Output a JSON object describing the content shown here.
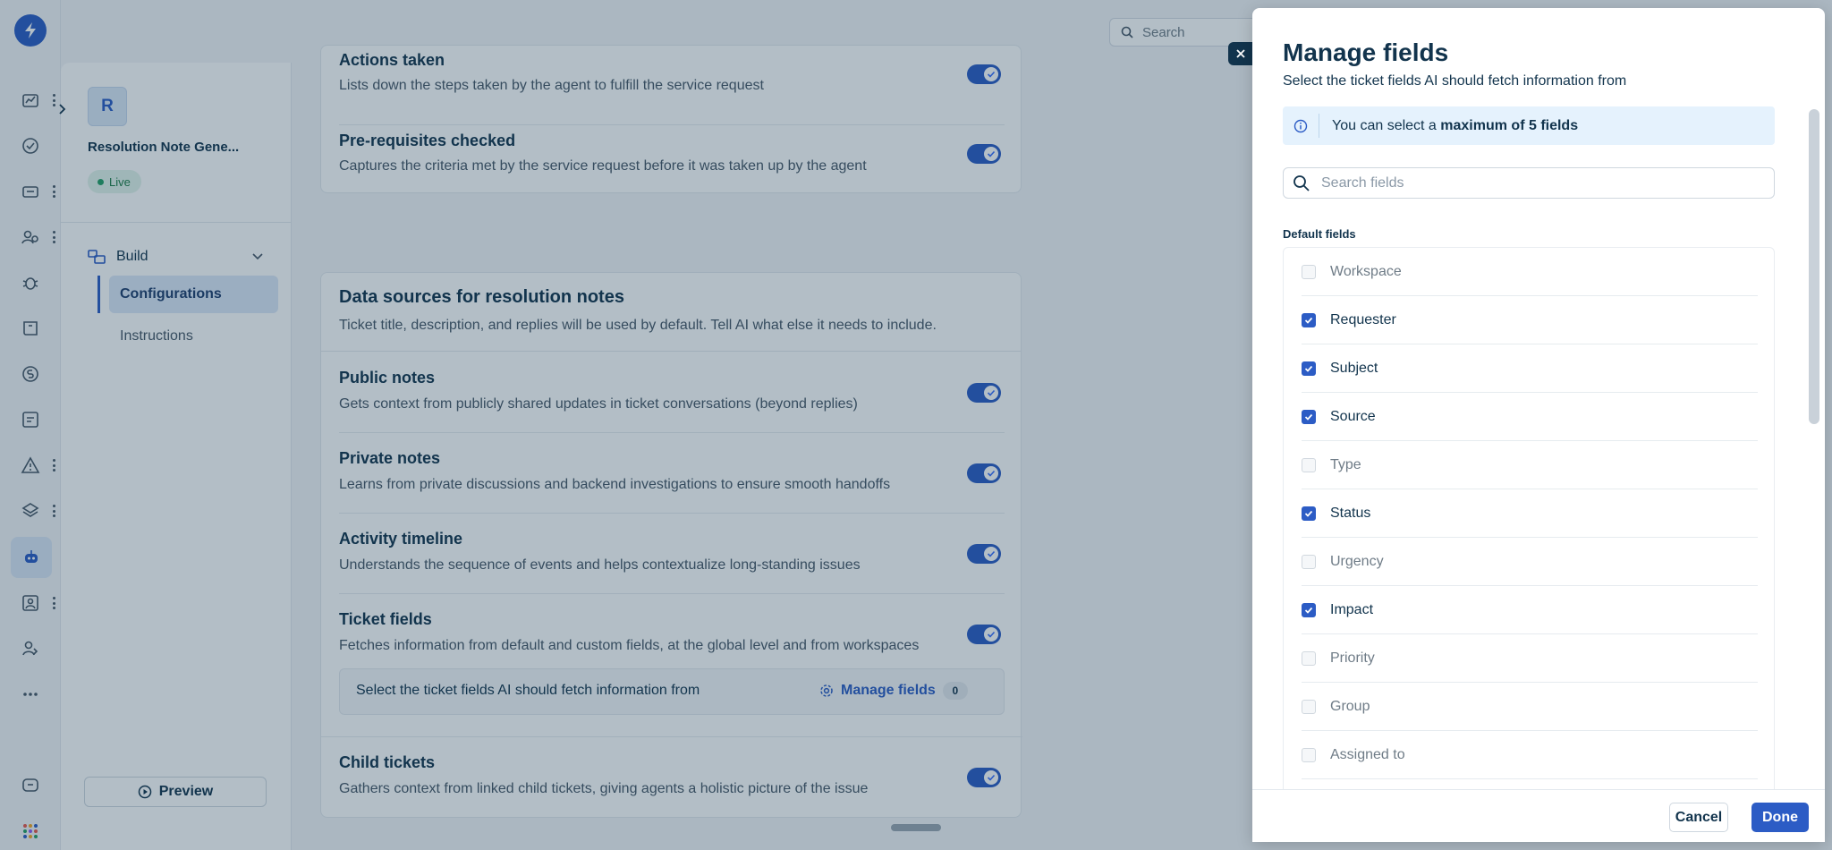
{
  "search": {
    "placeholder": "Search"
  },
  "agent": {
    "avatar_letter": "R",
    "name": "Resolution Note Gene...",
    "status": "Live"
  },
  "nav": {
    "build_label": "Build",
    "items": [
      {
        "label": "Configurations"
      },
      {
        "label": "Instructions"
      }
    ],
    "preview_label": "Preview"
  },
  "rail": {
    "icons": [
      "dashboard-icon",
      "check-icon",
      "tickets-icon",
      "contacts-icon",
      "bug-icon",
      "book-icon",
      "billing-icon",
      "reports-icon",
      "alert-icon",
      "layers-icon",
      "bot-icon",
      "inbox-icon",
      "team-icon",
      "more-icon",
      "chat-icon",
      "apps-icon"
    ]
  },
  "actions_card": {
    "rows": [
      {
        "title": "Actions taken",
        "desc": "Lists down the steps taken by the agent to fulfill the service request",
        "enabled": true
      },
      {
        "title": "Pre-requisites checked",
        "desc": "Captures the criteria met by the service request before it was taken up by the agent",
        "enabled": true
      }
    ]
  },
  "data_sources": {
    "title": "Data sources for resolution notes",
    "subtitle": "Ticket title, description, and replies will be used by default. Tell AI what else it needs to include.",
    "rows": [
      {
        "title": "Public notes",
        "desc": "Gets context from publicly shared updates in ticket conversations (beyond replies)",
        "enabled": true
      },
      {
        "title": "Private notes",
        "desc": "Learns from private discussions and backend investigations to ensure smooth handoffs",
        "enabled": true
      },
      {
        "title": "Activity timeline",
        "desc": "Understands the sequence of events and helps contextualize long-standing issues",
        "enabled": true
      },
      {
        "title": "Ticket fields",
        "desc": "Fetches information from default and custom fields, at the global level and from workspaces",
        "enabled": true
      },
      {
        "title": "Child tickets",
        "desc": "Gathers context from linked child tickets, giving agents a holistic picture of the issue",
        "enabled": true
      }
    ],
    "manage_bar": {
      "text": "Select the ticket fields AI should fetch information from",
      "link_label": "Manage fields",
      "count": "0"
    }
  },
  "panel": {
    "title": "Manage fields",
    "subtitle": "Select the ticket fields AI should fetch information from",
    "info_prefix": "You can select a ",
    "info_bold": "maximum of 5 fields",
    "search_placeholder": "Search fields",
    "section_label": "Default fields",
    "fields": [
      {
        "label": "Workspace",
        "checked": false
      },
      {
        "label": "Requester",
        "checked": true
      },
      {
        "label": "Subject",
        "checked": true
      },
      {
        "label": "Source",
        "checked": true
      },
      {
        "label": "Type",
        "checked": false
      },
      {
        "label": "Status",
        "checked": true
      },
      {
        "label": "Urgency",
        "checked": false
      },
      {
        "label": "Impact",
        "checked": true
      },
      {
        "label": "Priority",
        "checked": false
      },
      {
        "label": "Group",
        "checked": false
      },
      {
        "label": "Assigned to",
        "checked": false
      }
    ],
    "cancel_label": "Cancel",
    "done_label": "Done"
  }
}
